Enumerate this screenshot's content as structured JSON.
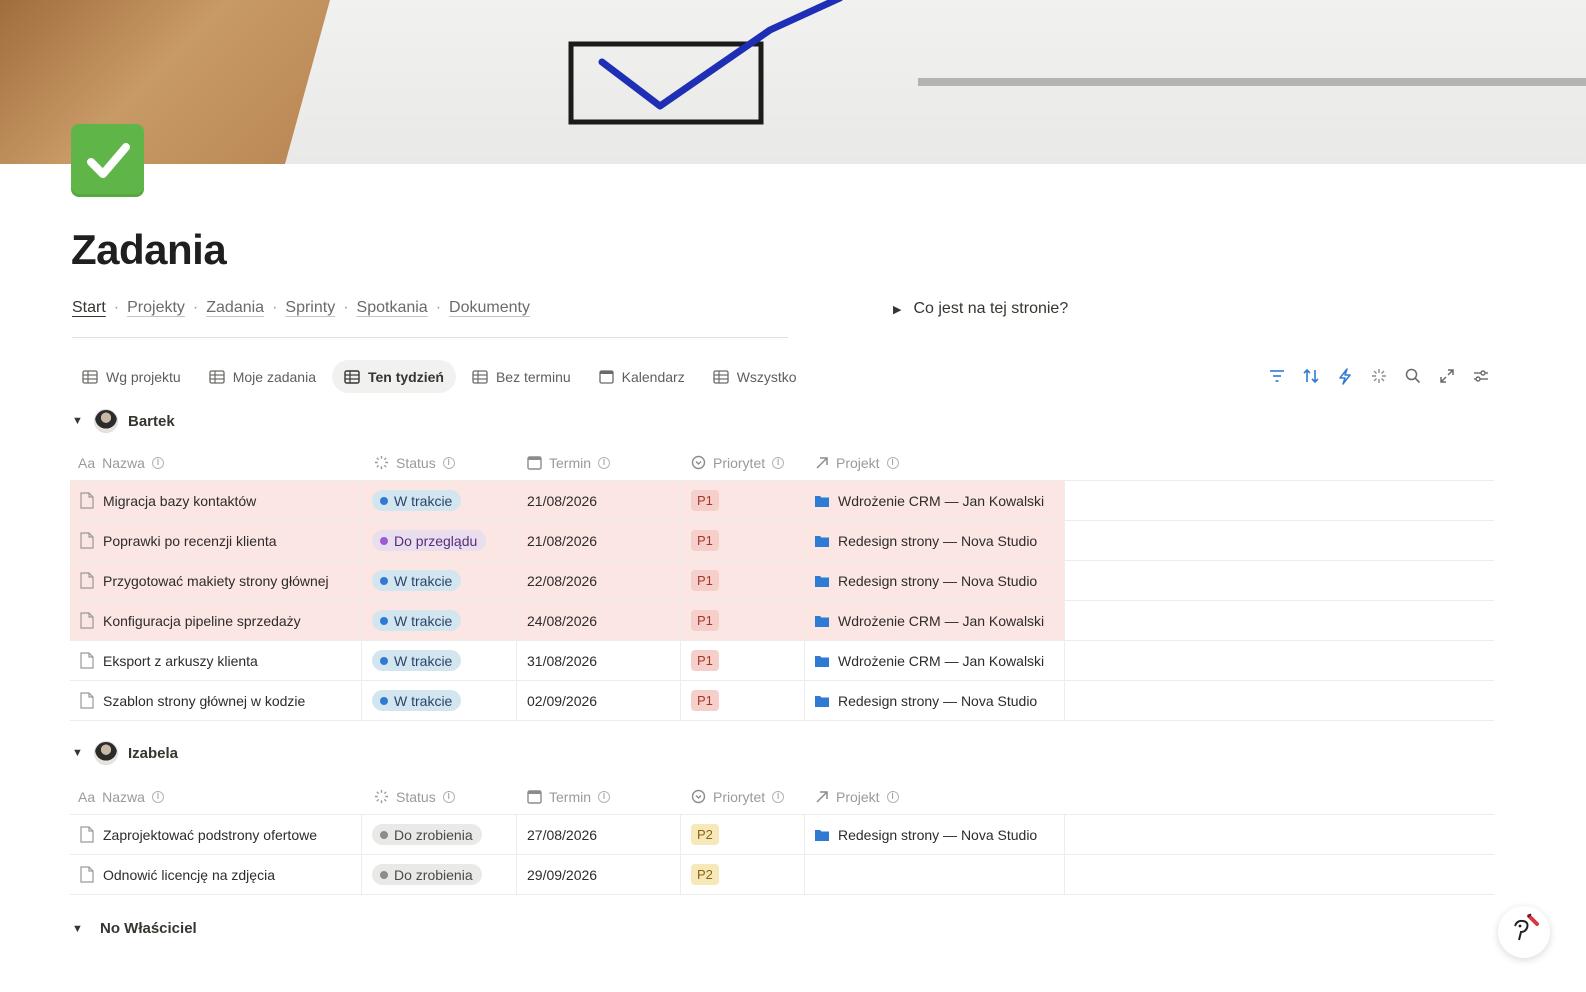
{
  "page": {
    "title": "Zadania",
    "icon": "green-checkmark-icon",
    "cover": "checkbox-paper-photo"
  },
  "breadcrumbs": [
    {
      "label": "Start",
      "active": true
    },
    {
      "label": "Projekty"
    },
    {
      "label": "Zadania"
    },
    {
      "label": "Sprinty"
    },
    {
      "label": "Spotkania"
    },
    {
      "label": "Dokumenty"
    }
  ],
  "toggle_info": {
    "label": "Co jest na tej stronie?"
  },
  "tabs": [
    {
      "label": "Wg projektu",
      "icon": "table-icon"
    },
    {
      "label": "Moje zadania",
      "icon": "table-icon"
    },
    {
      "label": "Ten tydzień",
      "icon": "table-icon",
      "active": true
    },
    {
      "label": "Bez terminu",
      "icon": "table-icon"
    },
    {
      "label": "Kalendarz",
      "icon": "calendar-icon"
    },
    {
      "label": "Wszystko",
      "icon": "table-icon"
    }
  ],
  "toolbar": [
    "filter-icon",
    "sort-icon",
    "lightning-icon",
    "sparkle-icon",
    "search-icon",
    "expand-icon",
    "settings-sliders-icon"
  ],
  "columns": {
    "name": "Nazwa",
    "name_prefix": "Aa",
    "status": "Status",
    "due": "Termin",
    "priority": "Priorytet",
    "project": "Projekt"
  },
  "groups": [
    {
      "owner": "Bartek",
      "rows": [
        {
          "name": "Migracja bazy kontaktów",
          "status": "W trakcie",
          "status_color": "blue",
          "due": "21/08/2026",
          "priority": "P1",
          "project": "Wdrożenie CRM — Jan Kowalski",
          "highlight": true
        },
        {
          "name": "Poprawki po recenzji klienta",
          "status": "Do przeglądu",
          "status_color": "purple",
          "due": "21/08/2026",
          "priority": "P1",
          "project": "Redesign strony — Nova Studio",
          "highlight": true
        },
        {
          "name": "Przygotować makiety strony głównej",
          "status": "W trakcie",
          "status_color": "blue",
          "due": "22/08/2026",
          "priority": "P1",
          "project": "Redesign strony — Nova Studio",
          "highlight": true
        },
        {
          "name": "Konfiguracja pipeline sprzedaży",
          "status": "W trakcie",
          "status_color": "blue",
          "due": "24/08/2026",
          "priority": "P1",
          "project": "Wdrożenie CRM — Jan Kowalski",
          "highlight": true
        },
        {
          "name": "Eksport z arkuszy klienta",
          "status": "W trakcie",
          "status_color": "blue",
          "due": "31/08/2026",
          "priority": "P1",
          "project": "Wdrożenie CRM — Jan Kowalski",
          "highlight": false
        },
        {
          "name": "Szablon strony głównej w kodzie",
          "status": "W trakcie",
          "status_color": "blue",
          "due": "02/09/2026",
          "priority": "P1",
          "project": "Redesign strony — Nova Studio",
          "highlight": false
        }
      ]
    },
    {
      "owner": "Izabela",
      "rows": [
        {
          "name": "Zaprojektować podstrony ofertowe",
          "status": "Do zrobienia",
          "status_color": "gray",
          "due": "27/08/2026",
          "priority": "P2",
          "project": "Redesign strony — Nova Studio",
          "highlight": false
        },
        {
          "name": "Odnowić licencję na zdjęcia",
          "status": "Do zrobienia",
          "status_color": "gray",
          "due": "29/09/2026",
          "priority": "P2",
          "project": "",
          "highlight": false
        }
      ]
    },
    {
      "owner": "No Właściciel",
      "rows": []
    }
  ],
  "colors": {
    "highlight_row": "#fbe6e3",
    "accent_blue": "#2f7bd3",
    "icon_green": "#5fb548"
  }
}
